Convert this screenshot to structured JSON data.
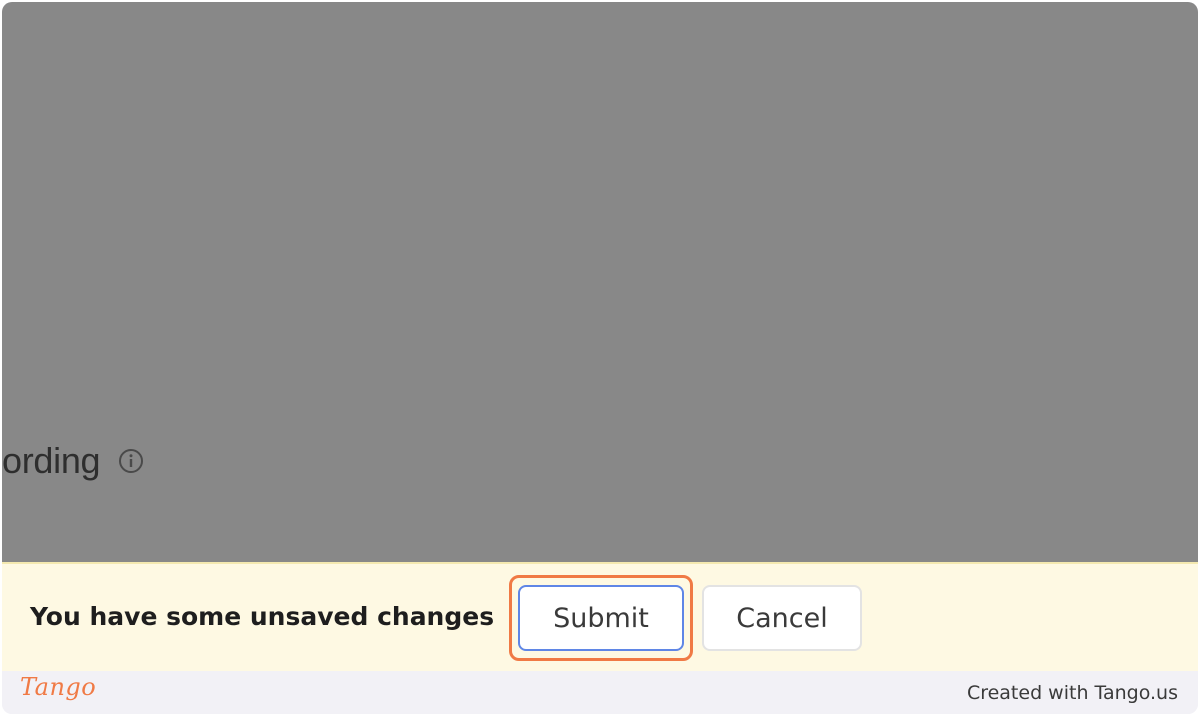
{
  "setting": {
    "label": "ording",
    "info_icon": "info-circle-icon"
  },
  "unsaved_bar": {
    "message": "You have some unsaved changes",
    "submit_label": "Submit",
    "cancel_label": "Cancel"
  },
  "footer": {
    "logo_text": "Tango",
    "credit": "Created with Tango.us"
  },
  "colors": {
    "overlay": "#888888",
    "bar_background": "#fef9e3",
    "highlight": "#f07a45",
    "submit_border": "#5f86e6",
    "footer_background": "#f2f1f6"
  }
}
